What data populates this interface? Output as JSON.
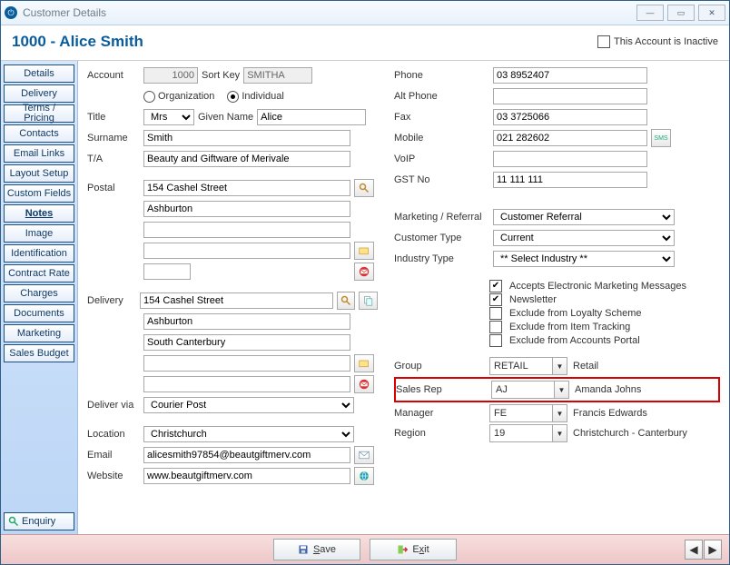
{
  "window": {
    "title": "Customer Details"
  },
  "header": {
    "title": "1000 - Alice Smith",
    "inactive_label": "This Account is Inactive",
    "inactive_checked": false
  },
  "sidebar": {
    "tabs": [
      "Details",
      "Delivery",
      "Terms / Pricing",
      "Contacts",
      "Email Links",
      "Layout Setup",
      "Custom Fields",
      "Notes",
      "Image",
      "Identification",
      "Contract Rate",
      "Charges",
      "Documents",
      "Marketing",
      "Sales Budget"
    ],
    "selected": "Notes",
    "enquiry": "Enquiry"
  },
  "left": {
    "account_label": "Account",
    "account_value": "1000",
    "sortkey_label": "Sort Key",
    "sortkey_value": "SMITHA",
    "type_org": "Organization",
    "type_ind": "Individual",
    "type_selected": "Individual",
    "title_label": "Title",
    "title_value": "Mrs",
    "given_label": "Given Name",
    "given_value": "Alice",
    "surname_label": "Surname",
    "surname_value": "Smith",
    "ta_label": "T/A",
    "ta_value": "Beauty and Giftware of Merivale",
    "postal_label": "Postal",
    "postal": [
      "154 Cashel Street",
      "Ashburton",
      "",
      "",
      ""
    ],
    "postal_code": "",
    "delivery_label": "Delivery",
    "delivery": [
      "154 Cashel Street",
      "Ashburton",
      "South Canterbury",
      "",
      ""
    ],
    "deliver_via_label": "Deliver via",
    "deliver_via_value": "Courier Post",
    "location_label": "Location",
    "location_value": "Christchurch",
    "email_label": "Email",
    "email_value": "alicesmith97854@beautgiftmerv.com",
    "website_label": "Website",
    "website_value": "www.beautgiftmerv.com"
  },
  "right": {
    "phone_label": "Phone",
    "phone_value": "03 8952407",
    "altphone_label": "Alt Phone",
    "altphone_value": "",
    "fax_label": "Fax",
    "fax_value": "03 3725066",
    "mobile_label": "Mobile",
    "mobile_value": "021 282602",
    "voip_label": "VoIP",
    "voip_value": "",
    "gst_label": "GST No",
    "gst_value": "11 111 111",
    "marketing_label": "Marketing / Referral",
    "marketing_value": "Customer Referral",
    "ctype_label": "Customer Type",
    "ctype_value": "Current",
    "industry_label": "Industry Type",
    "industry_value": "** Select Industry **",
    "checks": [
      {
        "label": "Accepts Electronic Marketing Messages",
        "checked": true
      },
      {
        "label": "Newsletter",
        "checked": true
      },
      {
        "label": "Exclude from Loyalty Scheme",
        "checked": false
      },
      {
        "label": "Exclude from Item Tracking",
        "checked": false
      },
      {
        "label": "Exclude from Accounts Portal",
        "checked": false
      }
    ],
    "assoc": [
      {
        "label": "Group",
        "code": "RETAIL",
        "name": "Retail",
        "hl": false
      },
      {
        "label": "Sales Rep",
        "code": "AJ",
        "name": "Amanda Johns",
        "hl": true
      },
      {
        "label": "Manager",
        "code": "FE",
        "name": "Francis Edwards",
        "hl": false
      },
      {
        "label": "Region",
        "code": "19",
        "name": "Christchurch - Canterbury",
        "hl": false
      }
    ]
  },
  "footer": {
    "save": "Save",
    "exit": "Exit"
  }
}
